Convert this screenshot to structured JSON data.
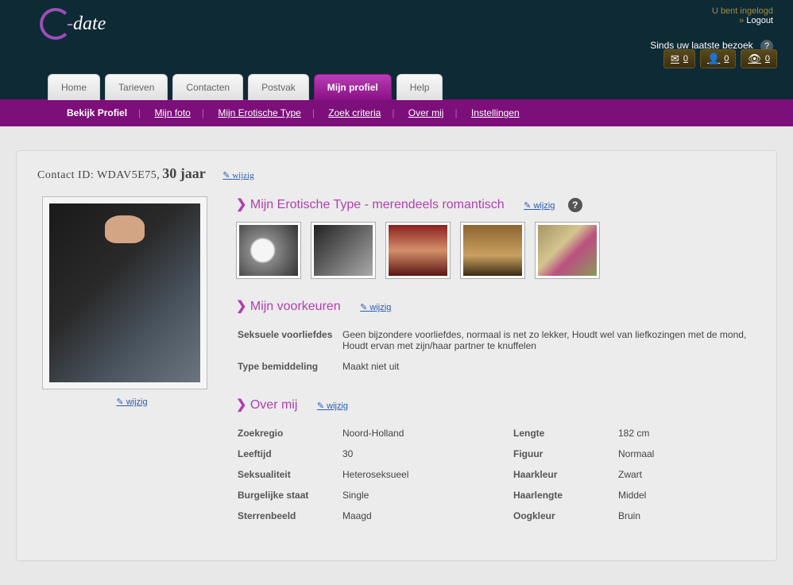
{
  "header": {
    "logged_in": "U bent ingelogd",
    "logout_prefix": "» ",
    "logout": "Logout",
    "visit_label": "Sinds uw laatste bezoek"
  },
  "counters": {
    "mail": "0",
    "contacts": "0",
    "views": "0"
  },
  "tabs": {
    "home": "Home",
    "tarieven": "Tarieven",
    "contacten": "Contacten",
    "postvak": "Postvak",
    "mijn_profiel": "Mijn profiel",
    "help": "Help"
  },
  "subnav": {
    "bekijk": "Bekijk Profiel",
    "mijn_foto": "Mijn foto",
    "erotische": "Mijn Erotische Type",
    "zoek": "Zoek criteria",
    "over_mij": "Over mij",
    "instellingen": "Instellingen"
  },
  "profile": {
    "contact_label": "Contact ID: ",
    "contact_id": "WDAV5E75",
    "age_text": "30 jaar",
    "edit": "wijzig"
  },
  "sections": {
    "erotic_title": "Mijn Erotische Type - merendeels romantisch",
    "voorkeuren_title": "Mijn voorkeuren",
    "over_mij_title": "Over mij"
  },
  "voorkeuren": {
    "pref_label": "Seksuele voorliefdes",
    "pref_value": "Geen bijzondere voorliefdes, normaal is net zo lekker, Houdt wel van liefkozingen met de mond, Houdt ervan met zijn/haar partner te knuffelen",
    "bemiddeling_label": "Type bemiddeling",
    "bemiddeling_value": "Maakt niet uit"
  },
  "about": {
    "zoekregio_l": "Zoekregio",
    "zoekregio_v": "Noord-Holland",
    "leeftijd_l": "Leeftijd",
    "leeftijd_v": "30",
    "seksualiteit_l": "Seksualiteit",
    "seksualiteit_v": "Heteroseksueel",
    "burgelijke_l": "Burgelijke staat",
    "burgelijke_v": "Single",
    "sterrenbeeld_l": "Sterrenbeeld",
    "sterrenbeeld_v": "Maagd",
    "lengte_l": "Lengte",
    "lengte_v": "182 cm",
    "figuur_l": "Figuur",
    "figuur_v": "Normaal",
    "haarkleur_l": "Haarkleur",
    "haarkleur_v": "Zwart",
    "haarlengte_l": "Haarlengte",
    "haarlengte_v": "Middel",
    "oogkleur_l": "Oogkleur",
    "oogkleur_v": "Bruin"
  }
}
